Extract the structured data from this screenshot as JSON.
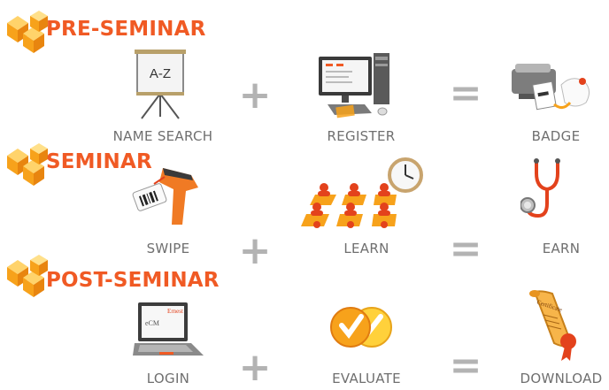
{
  "sections": [
    {
      "title": "PRE-SEMINAR",
      "steps": [
        {
          "label": "NAME SEARCH",
          "icon": "easel-az-icon",
          "easel_text": "A-Z"
        },
        {
          "label": "REGISTER",
          "icon": "computer-icon"
        },
        {
          "label": "BADGE",
          "icon": "badge-printer-icon"
        }
      ],
      "operators": [
        "+",
        "="
      ]
    },
    {
      "title": "SEMINAR",
      "steps": [
        {
          "label": "SWIPE",
          "icon": "barcode-scanner-icon"
        },
        {
          "label": "LEARN",
          "icon": "classroom-icon"
        },
        {
          "label": "EARN",
          "icon": "stethoscope-icon"
        }
      ],
      "operators": [
        "+",
        "="
      ]
    },
    {
      "title": "POST-SEMINAR",
      "steps": [
        {
          "label": "LOGIN",
          "icon": "laptop-icon",
          "screen_text": [
            "Ernest",
            "eCM"
          ]
        },
        {
          "label": "EVALUATE",
          "icon": "evaluate-checkmarks-icon"
        },
        {
          "label": "DOWNLOAD",
          "icon": "certificate-scroll-icon",
          "certificate_text": "Certificate"
        }
      ],
      "operators": [
        "+",
        "="
      ]
    }
  ],
  "colors": {
    "accent": "#f05a24",
    "label": "#6f6f6f",
    "operator": "#b3b3b3"
  }
}
